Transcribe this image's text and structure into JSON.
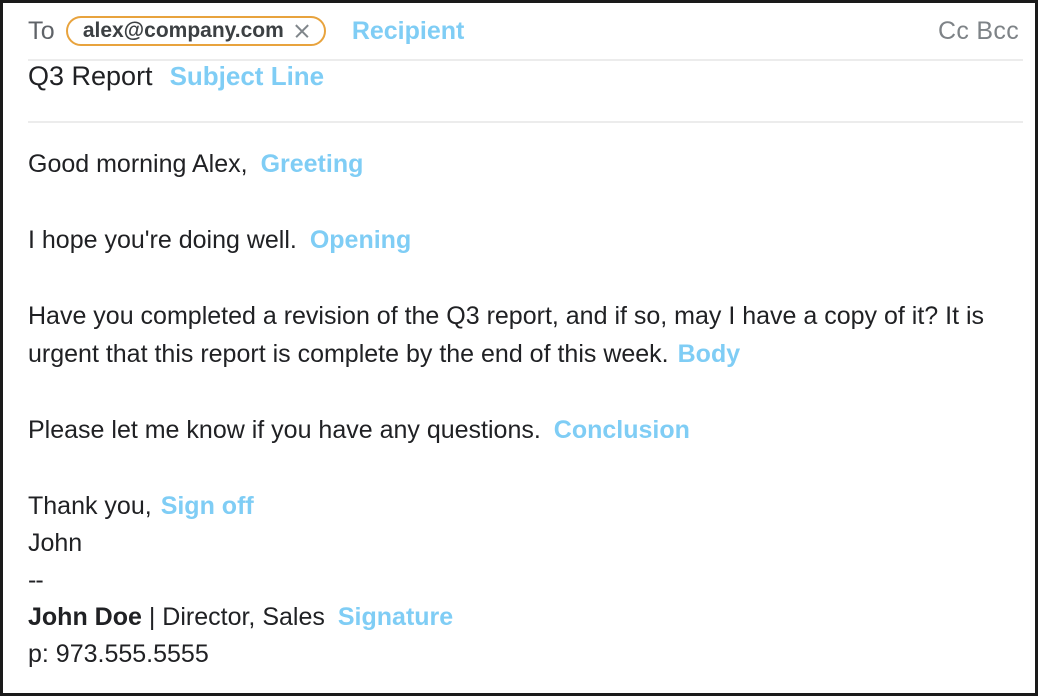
{
  "header": {
    "to_label": "To",
    "recipient": {
      "email": "alex@company.com",
      "close_icon": "close-icon"
    },
    "annotation": "Recipient",
    "cc_bcc": "Cc Bcc"
  },
  "subject": {
    "value": "Q3 Report",
    "annotation": "Subject Line"
  },
  "body": {
    "greeting": {
      "text": "Good morning Alex,",
      "annotation": "Greeting"
    },
    "opening": {
      "text": "I hope you're doing well.",
      "annotation": "Opening"
    },
    "main": {
      "text": "Have you completed a revision of the Q3 report, and if so, may I have a copy of it? It is urgent that this report is complete by the end of this week.",
      "annotation": "Body"
    },
    "conclusion": {
      "text": "Please let me know if you have any questions.",
      "annotation": "Conclusion"
    },
    "signoff": {
      "text": "Thank you,",
      "annotation": "Sign off",
      "name": "John"
    },
    "signature": {
      "separator": "--",
      "name": "John Doe",
      "title": "| Director, Sales",
      "annotation": "Signature",
      "phone": "p: 973.555.5555"
    }
  },
  "colors": {
    "annotation_blue": "#7fcdf5",
    "chip_border_orange": "#e8a33d",
    "text_dark": "#202124",
    "label_gray": "#5f6368",
    "divider_gray": "#ececec",
    "frame_black": "#1a1a1a"
  }
}
